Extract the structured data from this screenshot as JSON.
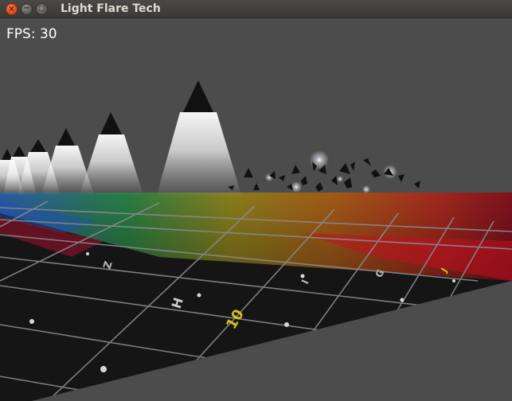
{
  "window": {
    "title": "Light Flare Tech",
    "controls": {
      "close_glyph": "×",
      "minimize_glyph": "−",
      "maximize_glyph": "□"
    }
  },
  "hud": {
    "fps_text": "FPS: 30"
  },
  "scene": {
    "background_color": "#4c4c4c",
    "floor_grid_colors": [
      "#c0102a",
      "#e04a10",
      "#d8a020",
      "#3aa040",
      "#2060c0",
      "#6a2ab0"
    ],
    "floor_labels": [
      "H",
      "10",
      "Z",
      "G",
      "I",
      "J"
    ]
  }
}
